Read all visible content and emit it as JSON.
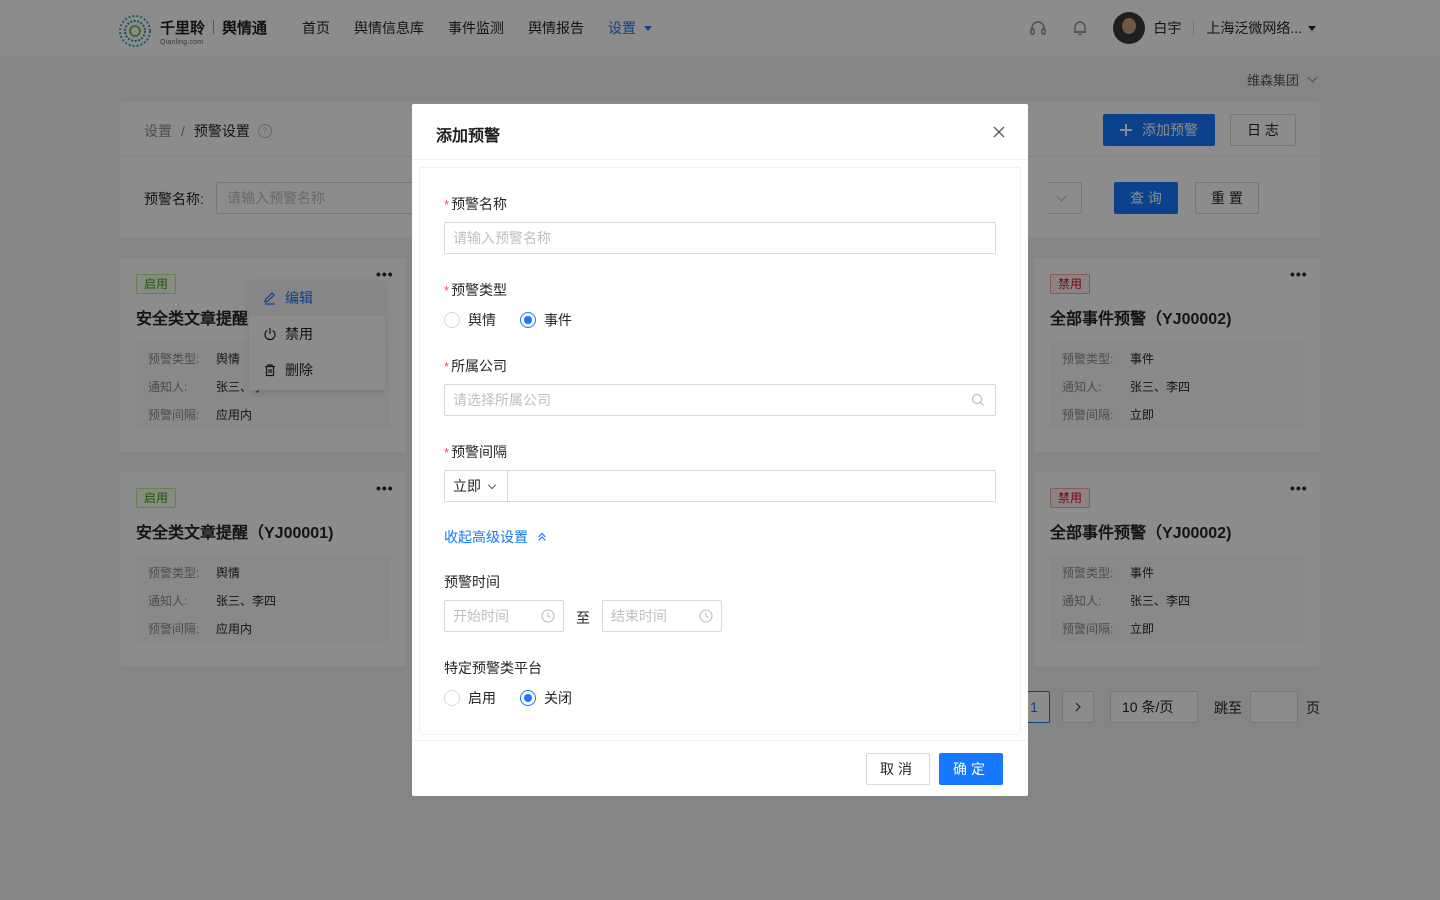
{
  "brand": {
    "name": "千里聆",
    "product": "舆情通",
    "sub": "Qianling.com"
  },
  "nav": [
    {
      "label": "首页"
    },
    {
      "label": "舆情信息库"
    },
    {
      "label": "事件监测"
    },
    {
      "label": "舆情报告"
    },
    {
      "label": "设置",
      "active": true
    }
  ],
  "user": {
    "name": "白宇",
    "company": "上海泛微网络..."
  },
  "group_select": "维森集团",
  "breadcrumb": {
    "root": "设置",
    "sep": "/",
    "current": "预警设置"
  },
  "toolbar": {
    "add_label": "添加预警",
    "log_label": "日 志"
  },
  "filter": {
    "name_label": "预警名称:",
    "name_placeholder": "请输入预警名称",
    "query_label": "查 询",
    "reset_label": "重 置"
  },
  "cards": [
    {
      "tag": "启用",
      "enabled": true,
      "title": "安全类文章提醒",
      "type_key": "预警类型:",
      "type": "舆情",
      "notify_key": "通知人:",
      "notify": "张三、李",
      "interval_key": "预警间隔:",
      "interval": "应用内"
    },
    {
      "tag": "禁用",
      "enabled": false,
      "title": "全部事件预警（YJ00002)",
      "type_key": "预警类型:",
      "type": "事件",
      "notify_key": "通知人:",
      "notify": "张三、李四",
      "interval_key": "预警间隔:",
      "interval": "立即"
    },
    {
      "tag": "启用",
      "enabled": true,
      "title": "安全类文章提醒（YJ00001)",
      "type_key": "预警类型:",
      "type": "舆情",
      "notify_key": "通知人:",
      "notify": "张三、李四",
      "interval_key": "预警间隔:",
      "interval": "应用内"
    },
    {
      "tag": "禁用",
      "enabled": false,
      "title": "全部事件预警（YJ00002)",
      "type_key": "预警类型:",
      "type": "事件",
      "notify_key": "通知人:",
      "notify": "张三、李四",
      "interval_key": "预警间隔:",
      "interval": "立即"
    }
  ],
  "card_menu": [
    {
      "label": "编辑",
      "icon": "edit-icon"
    },
    {
      "label": "禁用",
      "icon": "power-icon"
    },
    {
      "label": "删除",
      "icon": "trash-icon"
    }
  ],
  "pagination": {
    "current": "1",
    "page_size": "10 条/页",
    "jump_label": "跳至",
    "page_suffix": "页"
  },
  "modal": {
    "title": "添加预警",
    "name_label": "预警名称",
    "name_placeholder": "请输入预警名称",
    "type_label": "预警类型",
    "type_options": [
      "舆情",
      "事件"
    ],
    "type_selected": "事件",
    "company_label": "所属公司",
    "company_placeholder": "请选择所属公司",
    "interval_label": "预警间隔",
    "interval_value": "立即",
    "advanced_toggle": "收起高级设置",
    "time_label": "预警时间",
    "time_start_placeholder": "开始时间",
    "time_to": "至",
    "time_end_placeholder": "结束时间",
    "platform_label": "特定预警类平台",
    "platform_options": [
      "启用",
      "关闭"
    ],
    "platform_selected": "关闭",
    "cancel_label": "取消",
    "ok_label": "确定"
  },
  "colors": {
    "primary": "#1677ff",
    "enabled_tag": "#389e0d",
    "disabled_tag": "#cf1322",
    "required_mark": "#ff4d4f"
  }
}
